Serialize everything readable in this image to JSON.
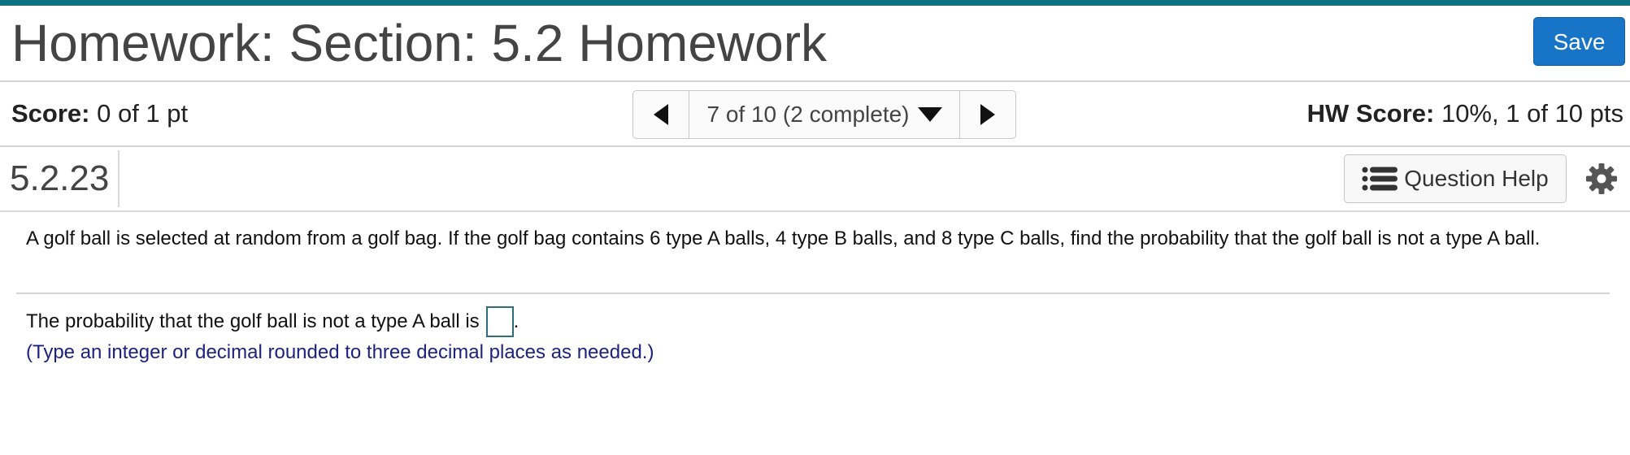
{
  "header": {
    "title": "Homework: Section: 5.2 Homework",
    "save_label": "Save",
    "accent_color": "#0e7285",
    "save_color": "#1874c6"
  },
  "score_row": {
    "score_label": "Score:",
    "score_value": "0 of 1 pt",
    "nav_selected": "7 of 10 (2 complete)",
    "hw_score_label": "HW Score:",
    "hw_score_value": "10%, 1 of 10 pts"
  },
  "question_row": {
    "question_id": "5.2.23",
    "help_label": "Question Help"
  },
  "question": {
    "text": "A golf ball is selected at random from a golf bag. If the golf bag contains 6 type A balls, 4 type B balls, and 8 type C balls, find the probability that the golf ball is not a type A ball.",
    "answer_prompt": "The probability that the golf ball is not a type A ball is",
    "answer_suffix": ".",
    "hint": "(Type an integer or decimal rounded to three decimal places as needed.)",
    "hint_color": "#1c2280"
  },
  "icons": {
    "prev": "triangle-left-icon",
    "next": "triangle-right-icon",
    "dropdown": "triangle-down-icon",
    "help": "list-icon",
    "settings": "gear-icon"
  }
}
